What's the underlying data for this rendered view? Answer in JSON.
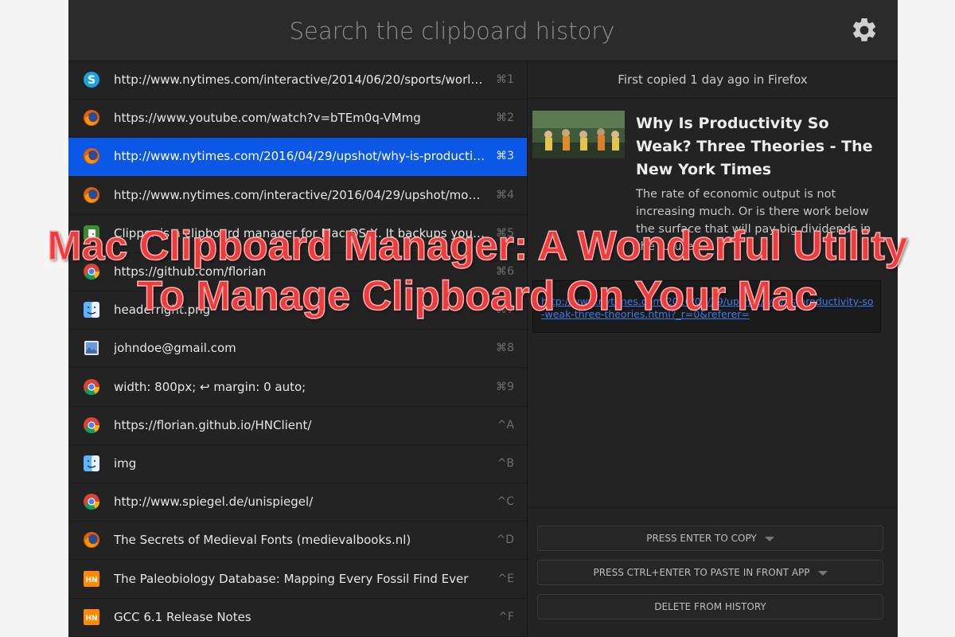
{
  "search": {
    "placeholder": "Search the clipboard history"
  },
  "items": [
    {
      "text": "http://www.nytimes.com/interactive/2014/06/20/sports/worl…",
      "key": "⌘1",
      "icon": "skype-icon"
    },
    {
      "text": "https://www.youtube.com/watch?v=bTEm0q-VMmg",
      "key": "⌘2",
      "icon": "firefox-icon"
    },
    {
      "text": "http://www.nytimes.com/2016/04/29/upshot/why-is-producti…",
      "key": "⌘3",
      "icon": "firefox-icon",
      "selected": true
    },
    {
      "text": "http://www.nytimes.com/interactive/2016/04/29/upshot/mo…",
      "key": "⌘4",
      "icon": "firefox-icon"
    },
    {
      "text": "Clipper is a clipboard manager for Mac OS X. It backups your…",
      "key": "⌘5",
      "icon": "evernote-icon"
    },
    {
      "text": "https://github.com/florian",
      "key": "⌘6",
      "icon": "chrome-icon"
    },
    {
      "text": "headerright.png",
      "key": "⌘7",
      "icon": "finder-icon"
    },
    {
      "text": "johndoe@gmail.com",
      "key": "⌘8",
      "icon": "preview-icon"
    },
    {
      "text": "width: 800px; ↩ margin: 0 auto;",
      "key": "⌘9",
      "icon": "chrome-icon"
    },
    {
      "text": "https://florian.github.io/HNClient/",
      "key": "^A",
      "icon": "chrome-icon"
    },
    {
      "text": "img",
      "key": "^B",
      "icon": "finder-icon"
    },
    {
      "text": "http://www.spiegel.de/unispiegel/",
      "key": "^C",
      "icon": "chrome-icon"
    },
    {
      "text": "The Secrets of Medieval Fonts (medievalbooks.nl)",
      "key": "^D",
      "icon": "firefox-icon"
    },
    {
      "text": "The Paleobiology Database: Mapping Every Fossil Find Ever",
      "key": "^E",
      "icon": "hn-icon"
    },
    {
      "text": "GCC 6.1 Release Notes",
      "key": "^F",
      "icon": "hn-icon"
    }
  ],
  "detail": {
    "copied_info": "First copied 1 day ago in Firefox",
    "title": "Why Is Productivity So Weak? Three Theories - The New York Times",
    "description": "The rate of economic output is not increasing much. Or is there work below the surface that will pay big dividends in the future?",
    "url": "http://www.nytimes.com/2016/04/29/upshot/why-is-productivity-so-weak-three-theories.html?_r=0&referer="
  },
  "actions": {
    "copy": "PRESS ENTER TO COPY",
    "paste": "PRESS CTRL+ENTER TO PASTE IN FRONT APP",
    "delete": "DELETE FROM HISTORY"
  },
  "overlay": {
    "line1": "Mac Clipboard Manager: A Wonderful Utility",
    "line2": "To Manage Clipboard On Your Mac"
  },
  "colors": {
    "accent": "#0b57e6",
    "overlay_text": "#ef3b3b",
    "link": "#3d7bf0"
  }
}
